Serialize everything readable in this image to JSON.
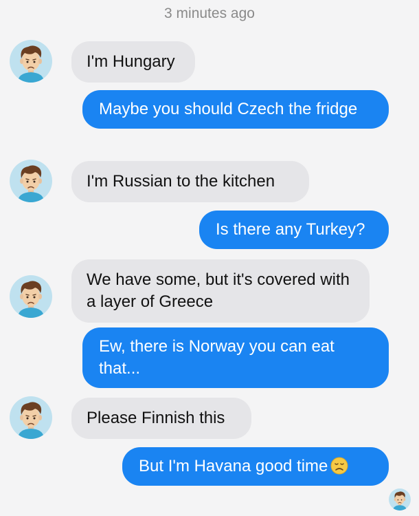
{
  "timestamp": "3 minutes ago",
  "messages": [
    {
      "side": "in",
      "text": "I'm Hungary"
    },
    {
      "side": "out",
      "text": "Maybe you should Czech the fridge"
    },
    {
      "side": "in",
      "text": "I'm Russian to the kitchen"
    },
    {
      "side": "out",
      "text": "Is there any Turkey?"
    },
    {
      "side": "in",
      "text": "We have some, but it's covered with a layer of Greece"
    },
    {
      "side": "out",
      "text": "Ew, there is Norway you can eat that..."
    },
    {
      "side": "in",
      "text": "Please Finnish this"
    },
    {
      "side": "out",
      "text": "But I'm Havana good time",
      "emoji": "sad-face-emoji"
    }
  ],
  "colors": {
    "outgoing_bubble": "#1a84f2",
    "incoming_bubble": "#e5e5e8",
    "background": "#f4f4f5"
  },
  "icons": {
    "avatar": "sad-boy-avatar-icon",
    "read_receipt": "sad-boy-avatar-icon"
  }
}
